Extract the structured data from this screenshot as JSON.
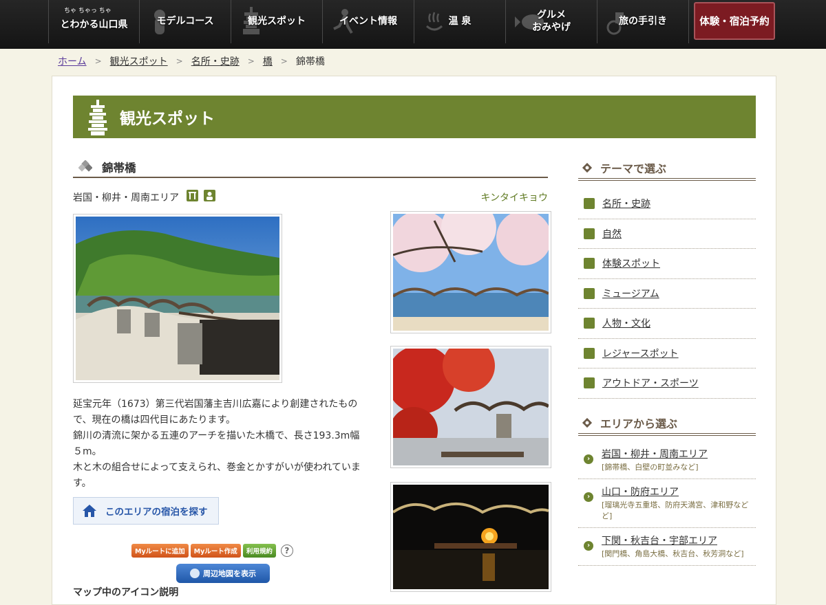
{
  "nav": {
    "items": [
      {
        "kicker": "ちゃ ちゃっ ちゃ",
        "label": "とわかる山口県"
      },
      {
        "label": "モデルコース"
      },
      {
        "label": "観光スポット"
      },
      {
        "label": "イベント情報"
      },
      {
        "label": "温 泉"
      },
      {
        "label": "グルメ\nおみやげ"
      },
      {
        "label": "旅の手引き"
      }
    ],
    "reserve_label": "体験・宿泊予約"
  },
  "breadcrumb": {
    "items": [
      "ホーム",
      "観光スポット",
      "名所・史跡",
      "橋"
    ],
    "current": "錦帯橋"
  },
  "banner": {
    "title": "観光スポット"
  },
  "spot": {
    "title": "錦帯橋",
    "area": "岩国・柳井・周南エリア",
    "reading": "キンタイキョウ",
    "description": [
      "延宝元年（1673）第三代岩国藩主吉川広嘉により創建されたもので、現在の橋は四代目にあたります。",
      "錦川の清流に架かる五連のアーチを描いた木橋で、長さ193.3m幅５m。",
      "木と木の組合せによって支えられ、巻金とかすがいが使われています。"
    ],
    "stay_button": "このエリアの宿泊を探す",
    "route_buttons": [
      "Myルートに追加",
      "Myルート作成",
      "利用規約"
    ],
    "map_button": "周辺地図を表示",
    "legend_title": "マップ中のアイコン説明"
  },
  "sidebar": {
    "theme_title": "テーマで選ぶ",
    "themes": [
      "名所・史跡",
      "自然",
      "体験スポット",
      "ミュージアム",
      "人物・文化",
      "レジャースポット",
      "アウトドア・スポーツ"
    ],
    "area_title": "エリアから選ぶ",
    "areas": [
      {
        "name": "岩国・柳井・周南エリア",
        "sub": "[錦帯橋、白壁の町並みなど]"
      },
      {
        "name": "山口・防府エリア",
        "sub": "[瑠璃光寺五重塔、防府天満宮、津和野などど]"
      },
      {
        "name": "下関・秋吉台・宇部エリア",
        "sub": "[関門橋、角島大橋、秋吉台、秋芳洞など]"
      }
    ]
  },
  "colors": {
    "accent_green": "#6e8430",
    "reserve_red": "#7c1b22",
    "heading_brown": "#6a5a48"
  }
}
